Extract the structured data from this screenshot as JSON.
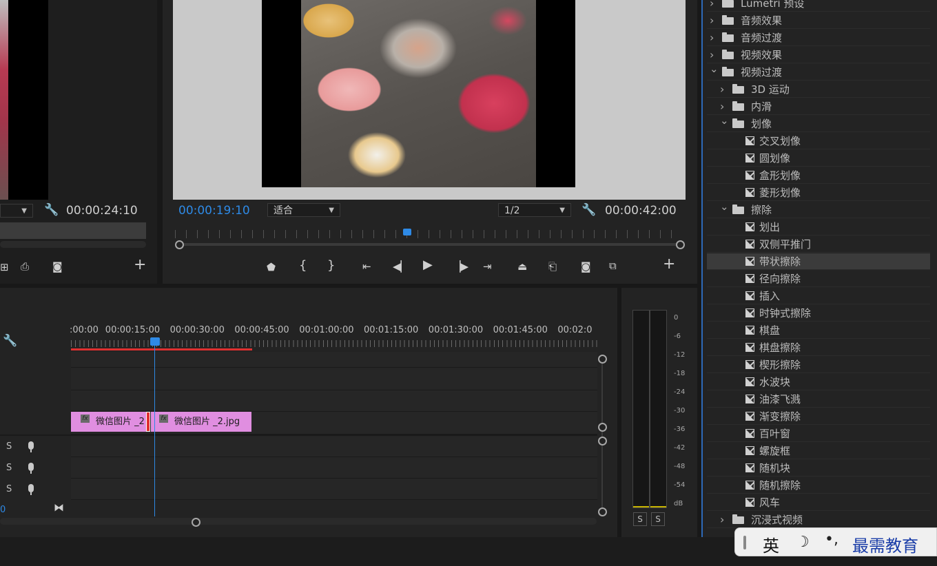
{
  "source_monitor": {
    "timecode": "00:00:24:10",
    "buttons": [
      "export-frame",
      "overwrite",
      "camera",
      "add"
    ]
  },
  "program_monitor": {
    "timecode_current": "00:00:19:10",
    "fit_select": "适合",
    "resolution_select": "1/2",
    "timecode_duration": "00:00:42:00",
    "transport": [
      "mark-in",
      "bracket-in",
      "bracket-out",
      "go-to-in",
      "step-back",
      "play",
      "step-forward",
      "go-to-out",
      "lift",
      "extract",
      "export-frame",
      "compare",
      "add"
    ]
  },
  "timeline": {
    "ruler_labels": [
      ":00:00",
      "00:00:15:00",
      "00:00:30:00",
      "00:00:45:00",
      "00:01:00:00",
      "00:01:15:00",
      "00:01:30:00",
      "00:01:45:00",
      "00:02:0"
    ],
    "clip1": "微信图片 _2",
    "clip2": "微信图片 _2.jpg",
    "fx_label": "fx",
    "audio_s": "S",
    "footer_value": "0"
  },
  "audio_meter": {
    "scale": [
      "0",
      "-6",
      "-12",
      "-18",
      "-24",
      "-30",
      "-36",
      "-42",
      "-48",
      "-54",
      "dB"
    ],
    "solo_left": "S",
    "solo_right": "S"
  },
  "effects_panel": {
    "items": [
      {
        "label": "Lumetri 预设",
        "type": "folder",
        "level": 0,
        "expanded": false
      },
      {
        "label": "音频效果",
        "type": "folder",
        "level": 0,
        "expanded": false
      },
      {
        "label": "音频过渡",
        "type": "folder",
        "level": 0,
        "expanded": false
      },
      {
        "label": "视频效果",
        "type": "folder",
        "level": 0,
        "expanded": false
      },
      {
        "label": "视频过渡",
        "type": "folder",
        "level": 0,
        "expanded": true
      },
      {
        "label": "3D 运动",
        "type": "folder",
        "level": 1,
        "expanded": false
      },
      {
        "label": "内滑",
        "type": "folder",
        "level": 1,
        "expanded": false
      },
      {
        "label": "划像",
        "type": "folder",
        "level": 1,
        "expanded": true
      },
      {
        "label": "交叉划像",
        "type": "effect",
        "level": 2
      },
      {
        "label": "圆划像",
        "type": "effect",
        "level": 2
      },
      {
        "label": "盒形划像",
        "type": "effect",
        "level": 2
      },
      {
        "label": "菱形划像",
        "type": "effect",
        "level": 2
      },
      {
        "label": "擦除",
        "type": "folder",
        "level": 1,
        "expanded": true
      },
      {
        "label": "划出",
        "type": "effect",
        "level": 2
      },
      {
        "label": "双侧平推门",
        "type": "effect",
        "level": 2
      },
      {
        "label": "带状擦除",
        "type": "effect",
        "level": 2,
        "selected": true
      },
      {
        "label": "径向擦除",
        "type": "effect",
        "level": 2
      },
      {
        "label": "插入",
        "type": "effect",
        "level": 2
      },
      {
        "label": "时钟式擦除",
        "type": "effect",
        "level": 2
      },
      {
        "label": "棋盘",
        "type": "effect",
        "level": 2
      },
      {
        "label": "棋盘擦除",
        "type": "effect",
        "level": 2
      },
      {
        "label": "楔形擦除",
        "type": "effect",
        "level": 2
      },
      {
        "label": "水波块",
        "type": "effect",
        "level": 2
      },
      {
        "label": "油漆飞溅",
        "type": "effect",
        "level": 2
      },
      {
        "label": "渐变擦除",
        "type": "effect",
        "level": 2
      },
      {
        "label": "百叶窗",
        "type": "effect",
        "level": 2
      },
      {
        "label": "螺旋框",
        "type": "effect",
        "level": 2
      },
      {
        "label": "随机块",
        "type": "effect",
        "level": 2
      },
      {
        "label": "随机擦除",
        "type": "effect",
        "level": 2
      },
      {
        "label": "风车",
        "type": "effect",
        "level": 2
      },
      {
        "label": "沉浸式视频",
        "type": "folder",
        "level": 1,
        "expanded": false
      }
    ]
  },
  "ime": {
    "lang": "英",
    "watermark": "最需教育"
  },
  "colors": {
    "accent_blue": "#2e8ae6",
    "clip_pink": "#e08ee0",
    "playhead_red": "#e03030"
  }
}
